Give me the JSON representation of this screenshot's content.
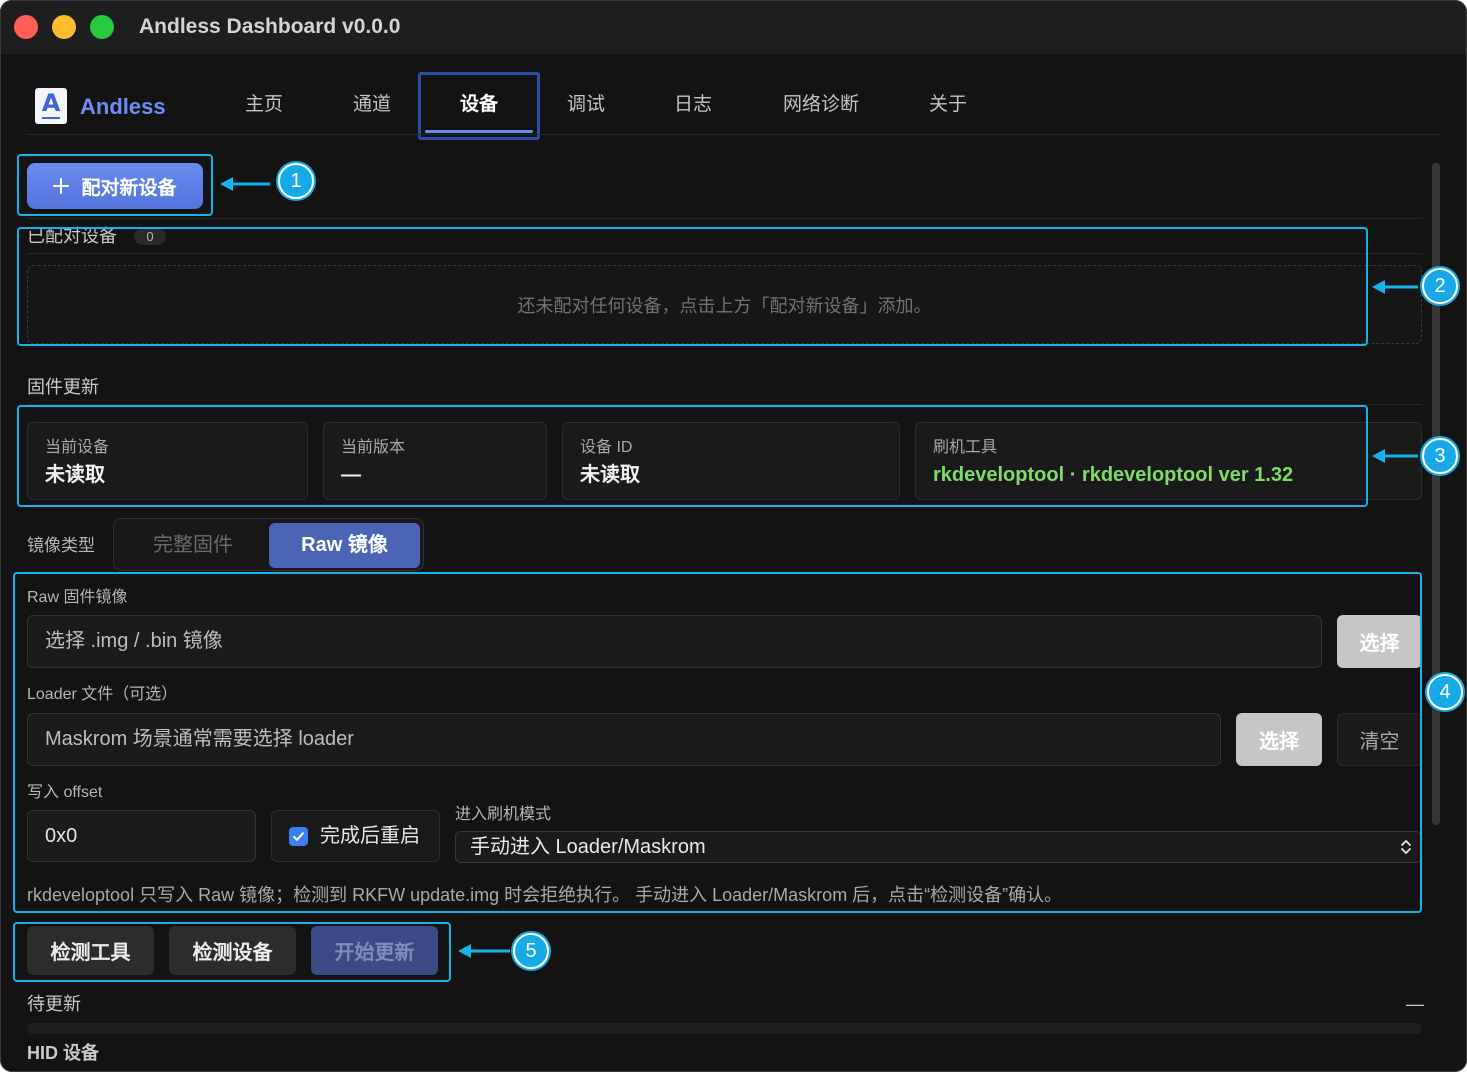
{
  "window": {
    "title": "Andless Dashboard v0.0.0"
  },
  "brand": {
    "logo_letter": "A",
    "logo_icon": "andless-logo-icon",
    "name": "Andless"
  },
  "nav": {
    "tabs": [
      {
        "label": "主页"
      },
      {
        "label": "通道"
      },
      {
        "label": "设备",
        "active": true
      },
      {
        "label": "调试"
      },
      {
        "label": "日志"
      },
      {
        "label": "网络诊断"
      },
      {
        "label": "关于"
      }
    ]
  },
  "pairing": {
    "add_button": {
      "icon": "plus-icon",
      "label": "配对新设备"
    },
    "paired_title": "已配对设备",
    "paired_count": "0",
    "empty_text": "还未配对任何设备，点击上方「配对新设备」添加。"
  },
  "firmware": {
    "title": "固件更新",
    "cards": [
      {
        "label": "当前设备",
        "value": "未读取"
      },
      {
        "label": "当前版本",
        "value": "—"
      },
      {
        "label": "设备 ID",
        "value": "未读取"
      },
      {
        "label": "刷机工具",
        "value": "rkdeveloptool · rkdeveloptool ver 1.32"
      }
    ],
    "image_type": {
      "label": "镜像类型",
      "options": [
        "完整固件",
        "Raw 镜像"
      ],
      "selected": "Raw 镜像"
    },
    "raw_image": {
      "label": "Raw 固件镜像",
      "placeholder": "选择 .img / .bin 镜像",
      "select_button": "选择"
    },
    "loader": {
      "label": "Loader 文件（可选）",
      "placeholder": "Maskrom 场景通常需要选择 loader",
      "select_button": "选择",
      "clear_button": "清空"
    },
    "offset": {
      "label": "写入 offset",
      "value": "0x0"
    },
    "reboot": {
      "label": "完成后重启",
      "checked": true,
      "icon": "check-icon"
    },
    "flash_mode": {
      "label": "进入刷机模式",
      "selected": "手动进入 Loader/Maskrom",
      "icon": "chevron-up-down-icon"
    },
    "note": "rkdeveloptool 只写入 Raw 镜像；检测到 RKFW update.img 时会拒绝执行。 手动进入 Loader/Maskrom 后，点击“检测设备”确认。",
    "actions": {
      "detect_tool": "检测工具",
      "detect_device": "检测设备",
      "start_update": "开始更新",
      "start_update_disabled": true
    },
    "status": {
      "label": "待更新",
      "value": "—",
      "progress": 0
    }
  },
  "hid": {
    "title": "HID 设备"
  },
  "annotations": [
    {
      "number": "1"
    },
    {
      "number": "2"
    },
    {
      "number": "3"
    },
    {
      "number": "4"
    },
    {
      "number": "5"
    }
  ],
  "colors": {
    "accent": "#5473db",
    "active_tab_underline": "#6d8cf2",
    "tool_ok": "#7fdc6a",
    "annotation": "#17b2ea",
    "checkbox": "#3b7ff5"
  }
}
